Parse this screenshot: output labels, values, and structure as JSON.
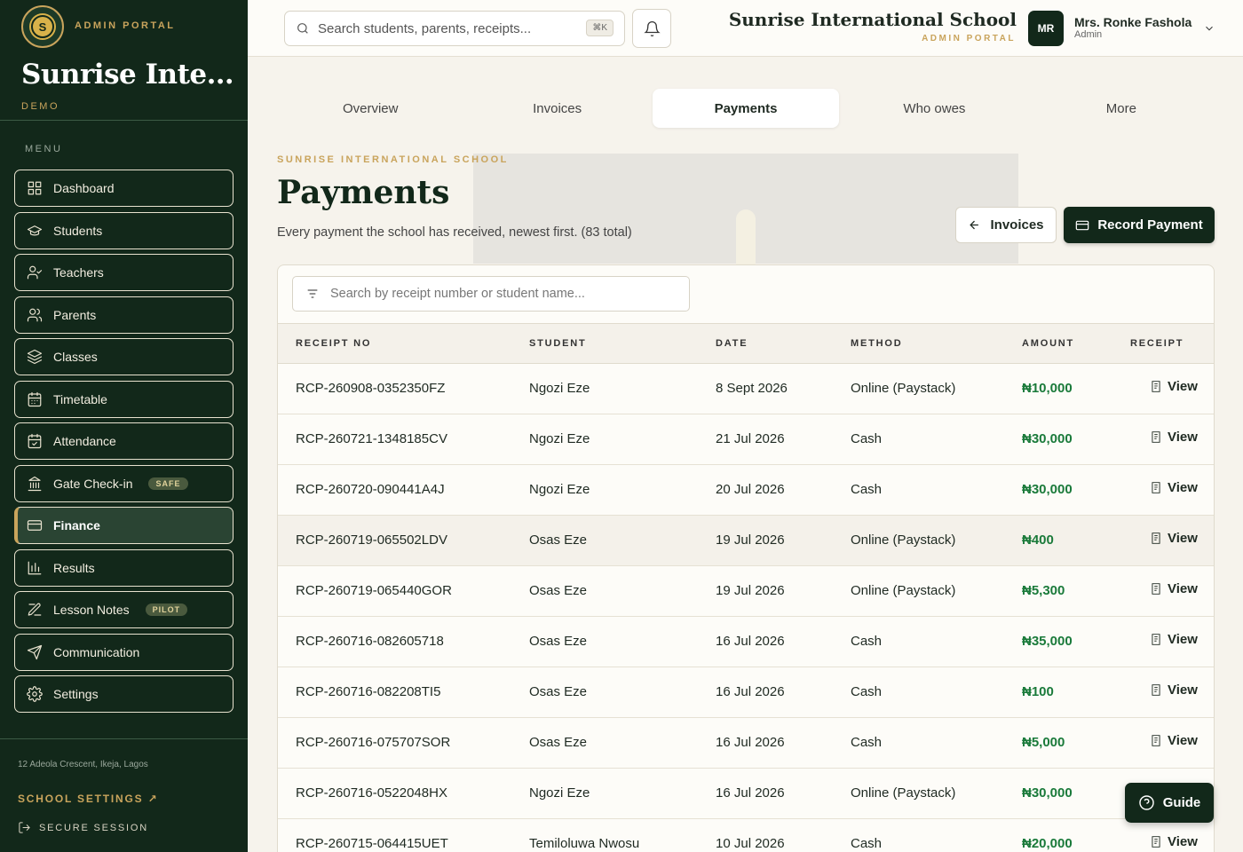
{
  "sidebar": {
    "logo_letter": "S",
    "portal_label": "ADMIN PORTAL",
    "school_name": "Sunrise Intern...",
    "demo_label": "DEMO",
    "menu_label": "MENU",
    "items": [
      {
        "label": "Dashboard",
        "icon": "grid-icon"
      },
      {
        "label": "Students",
        "icon": "graduation-cap-icon"
      },
      {
        "label": "Teachers",
        "icon": "user-check-icon"
      },
      {
        "label": "Parents",
        "icon": "users-icon"
      },
      {
        "label": "Classes",
        "icon": "layers-icon"
      },
      {
        "label": "Timetable",
        "icon": "calendar-icon"
      },
      {
        "label": "Attendance",
        "icon": "calendar-check-icon"
      },
      {
        "label": "Gate Check-in",
        "icon": "building-icon",
        "badge": "SAFE"
      },
      {
        "label": "Finance",
        "icon": "wallet-icon",
        "active": true
      },
      {
        "label": "Results",
        "icon": "bar-chart-icon"
      },
      {
        "label": "Lesson Notes",
        "icon": "notebook-icon",
        "badge": "PILOT"
      },
      {
        "label": "Communication",
        "icon": "send-icon"
      },
      {
        "label": "Settings",
        "icon": "gear-icon"
      }
    ],
    "address": "12 Adeola Crescent, Ikeja, Lagos",
    "school_settings": "SCHOOL SETTINGS ↗",
    "secure_session": "SECURE SESSION"
  },
  "header": {
    "search_placeholder": "Search students, parents, receipts...",
    "shortcut": "⌘K",
    "school_title": "Sunrise International School",
    "school_sub": "ADMIN PORTAL",
    "avatar_initials": "MR",
    "user_name": "Mrs. Ronke Fashola",
    "user_role": "Admin"
  },
  "tabs": [
    {
      "label": "Overview",
      "active": false
    },
    {
      "label": "Invoices",
      "active": false
    },
    {
      "label": "Payments",
      "active": true
    },
    {
      "label": "Who owes",
      "active": false
    },
    {
      "label": "More",
      "active": false
    }
  ],
  "page": {
    "eyebrow": "SUNRISE INTERNATIONAL SCHOOL",
    "title": "Payments",
    "subtitle": "Every payment the school has received, newest first. (83 total)",
    "invoices_button": "Invoices",
    "record_button": "Record Payment"
  },
  "table": {
    "search_placeholder": "Search by receipt number or student name...",
    "columns": [
      "RECEIPT NO",
      "STUDENT",
      "DATE",
      "METHOD",
      "AMOUNT",
      "RECEIPT"
    ],
    "view_label": "View",
    "rows": [
      {
        "receipt": "RCP-260908-0352350FZ",
        "student": "Ngozi Eze",
        "date": "8 Sept 2026",
        "method": "Online (Paystack)",
        "amount": "₦10,000"
      },
      {
        "receipt": "RCP-260721-1348185CV",
        "student": "Ngozi Eze",
        "date": "21 Jul 2026",
        "method": "Cash",
        "amount": "₦30,000"
      },
      {
        "receipt": "RCP-260720-090441A4J",
        "student": "Ngozi Eze",
        "date": "20 Jul 2026",
        "method": "Cash",
        "amount": "₦30,000"
      },
      {
        "receipt": "RCP-260719-065502LDV",
        "student": "Osas Eze",
        "date": "19 Jul 2026",
        "method": "Online (Paystack)",
        "amount": "₦400",
        "highlight": true
      },
      {
        "receipt": "RCP-260719-065440GOR",
        "student": "Osas Eze",
        "date": "19 Jul 2026",
        "method": "Online (Paystack)",
        "amount": "₦5,300"
      },
      {
        "receipt": "RCP-260716-082605718",
        "student": "Osas Eze",
        "date": "16 Jul 2026",
        "method": "Cash",
        "amount": "₦35,000"
      },
      {
        "receipt": "RCP-260716-082208TI5",
        "student": "Osas Eze",
        "date": "16 Jul 2026",
        "method": "Cash",
        "amount": "₦100"
      },
      {
        "receipt": "RCP-260716-075707SOR",
        "student": "Osas Eze",
        "date": "16 Jul 2026",
        "method": "Cash",
        "amount": "₦5,000"
      },
      {
        "receipt": "RCP-260716-0522048HX",
        "student": "Ngozi Eze",
        "date": "16 Jul 2026",
        "method": "Online (Paystack)",
        "amount": "₦30,000",
        "hide_view": true
      },
      {
        "receipt": "RCP-260715-064415UET",
        "student": "Temiloluwa Nwosu",
        "date": "10 Jul 2026",
        "method": "Cash",
        "amount": "₦20,000"
      }
    ]
  },
  "guide_label": "Guide",
  "colors": {
    "sidebar_bg": "#12281a",
    "accent_gold": "#c9a45c",
    "amount_green": "#1a7a3a",
    "page_bg": "#f6f3ec"
  }
}
